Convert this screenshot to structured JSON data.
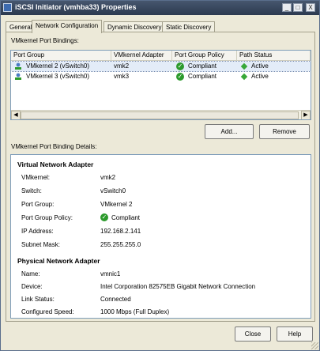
{
  "window": {
    "title": "iSCSI Initiator (vmhba33) Properties"
  },
  "titlebar_buttons": {
    "minimize": "_",
    "maximize": "□",
    "close": "X"
  },
  "tabs": [
    {
      "label": "General"
    },
    {
      "label": "Network Configuration"
    },
    {
      "label": "Dynamic Discovery"
    },
    {
      "label": "Static Discovery"
    }
  ],
  "bindings": {
    "section_label": "VMkernel Port Bindings:",
    "columns": [
      "Port Group",
      "VMkernel Adapter",
      "Port Group Policy",
      "Path Status"
    ],
    "rows": [
      {
        "port_group": "VMkernel 2 (vSwitch0)",
        "adapter": "vmk2",
        "policy": "Compliant",
        "status": "Active"
      },
      {
        "port_group": "VMkernel 3 (vSwitch0)",
        "adapter": "vmk3",
        "policy": "Compliant",
        "status": "Active"
      }
    ]
  },
  "buttons": {
    "add": "Add...",
    "remove": "Remove",
    "close": "Close",
    "help": "Help"
  },
  "details": {
    "section_label": "VMkernel Port Binding Details:",
    "virtual": {
      "heading": "Virtual Network Adapter",
      "vmkernel_label": "VMkernel:",
      "vmkernel": "vmk2",
      "switch_label": "Switch:",
      "switch": "vSwitch0",
      "portgroup_label": "Port Group:",
      "portgroup": "VMkernel 2",
      "policy_label": "Port Group Policy:",
      "policy": "Compliant",
      "ip_label": "IP Address:",
      "ip": "192.168.2.141",
      "mask_label": "Subnet Mask:",
      "mask": "255.255.255.0"
    },
    "physical": {
      "heading": "Physical Network Adapter",
      "name_label": "Name:",
      "name": "vmnic1",
      "device_label": "Device:",
      "device": "Intel Corporation 82575EB Gigabit Network Connection",
      "link_label": "Link Status:",
      "link": "Connected",
      "speed_label": "Configured Speed:",
      "speed": "1000 Mbps (Full Duplex)"
    }
  },
  "colors": {
    "accent": "#2c9a2c",
    "selection": "#e3ecf8",
    "titlebar": "#2c3a50"
  }
}
